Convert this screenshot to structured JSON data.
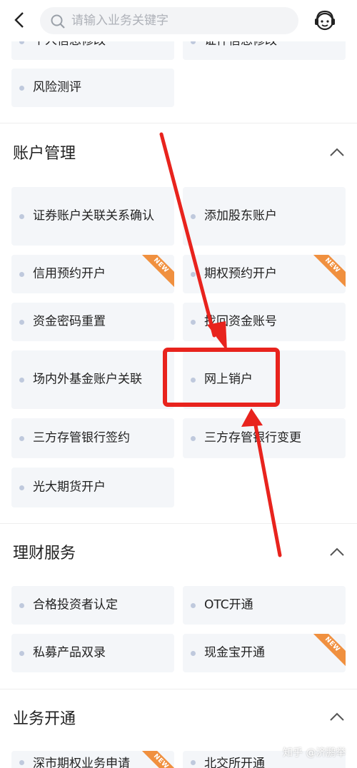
{
  "header": {
    "search_placeholder": "请输入业务关键字",
    "icons": {
      "back": "chevron-left-icon",
      "search": "search-icon",
      "customer_service": "customer-service-icon"
    }
  },
  "top_partial": {
    "items": [
      {
        "label": "个人信息修改"
      },
      {
        "label": "证件信息修改"
      },
      {
        "label": "风险测评"
      }
    ]
  },
  "sections": [
    {
      "title": "账户管理",
      "items": [
        {
          "label": "证券账户关联关系确认",
          "badge": ""
        },
        {
          "label": "添加股东账户",
          "badge": ""
        },
        {
          "label": "信用预约开户",
          "badge": "NEW"
        },
        {
          "label": "期权预约开户",
          "badge": "NEW"
        },
        {
          "label": "资金密码重置",
          "badge": ""
        },
        {
          "label": "找回资金账号",
          "badge": ""
        },
        {
          "label": "场内外基金账户关联",
          "badge": ""
        },
        {
          "label": "网上销户",
          "badge": ""
        },
        {
          "label": "三方存管银行签约",
          "badge": ""
        },
        {
          "label": "三方存管银行变更",
          "badge": ""
        },
        {
          "label": "光大期货开户",
          "badge": ""
        }
      ]
    },
    {
      "title": "理财服务",
      "items": [
        {
          "label": "合格投资者认定",
          "badge": ""
        },
        {
          "label": "OTC开通",
          "badge": ""
        },
        {
          "label": "私募产品双录",
          "badge": ""
        },
        {
          "label": "现金宝开通",
          "badge": "NEW"
        }
      ]
    },
    {
      "title": "业务开通",
      "items": [
        {
          "label": "深市期权业务申请",
          "badge": "NEW"
        },
        {
          "label": "北交所开通",
          "badge": ""
        }
      ]
    }
  ],
  "annotation": {
    "color": "#e8231d",
    "highlight_target": "网上销户"
  },
  "watermark": "知乎 @济鹏举",
  "colors": {
    "tile_bg": "#f4f6f9",
    "dot": "#bfc9dd",
    "badge": "#f0903f",
    "text": "#222222",
    "placeholder": "#aeb1b8"
  }
}
